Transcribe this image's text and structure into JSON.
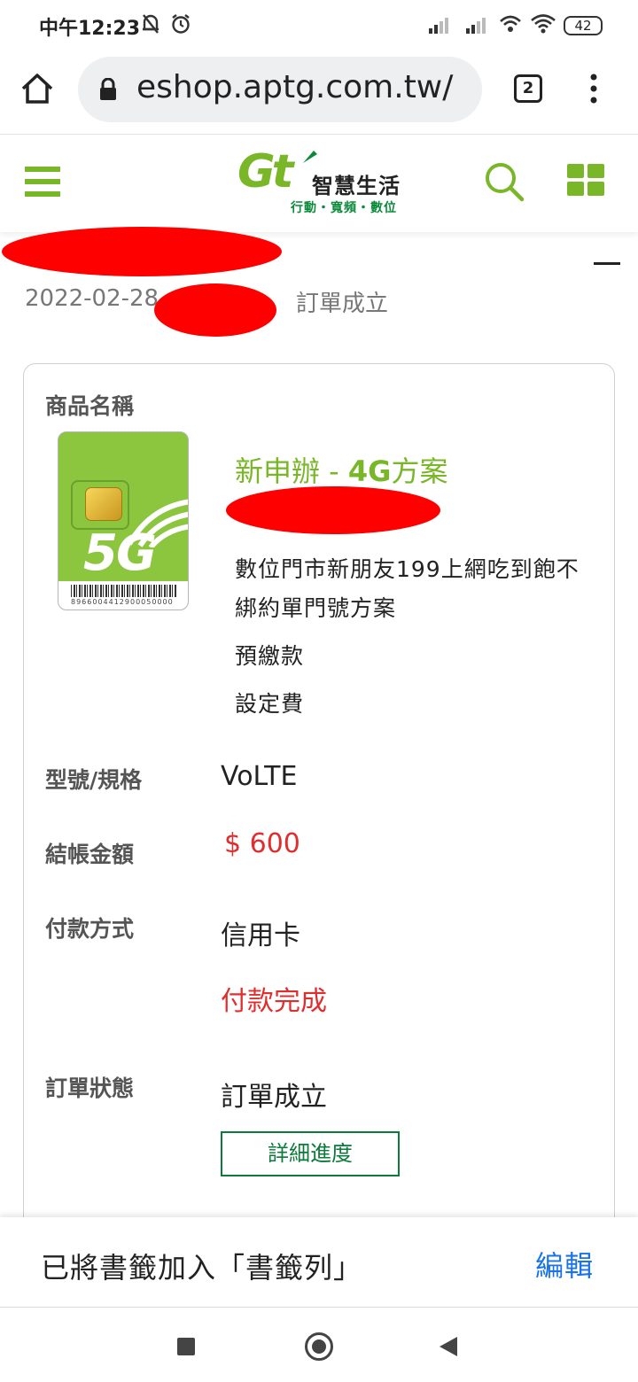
{
  "status_bar": {
    "time": "中午12:23",
    "battery": "42"
  },
  "browser": {
    "url": "eshop.aptg.com.tw/",
    "tab_count": "2"
  },
  "site": {
    "logo_mark": "Gt",
    "logo_name": "智慧生活",
    "logo_tagline": "行動・寬頻・數位",
    "brand_color": "#79b729"
  },
  "order": {
    "date": "2022-02-28",
    "status": "訂單成立"
  },
  "product": {
    "section_label": "商品名稱",
    "title_prefix": "新申辦 - ",
    "title_bold": "4G",
    "title_suffix": "方案",
    "description": "數位門市新朋友199上網吃到飽不綁約單門號方案",
    "item_prepaid": "預繳款",
    "item_setup": "設定費",
    "sim_number": "8966004412900050000",
    "sim_badge": "5G"
  },
  "details": {
    "spec_label": "型號/規格",
    "spec_value": "VoLTE",
    "amount_label": "結帳金額",
    "amount_value": "$ 600",
    "payment_label": "付款方式",
    "payment_method": "信用卡",
    "payment_status": "付款完成",
    "order_status_label": "訂單狀態",
    "order_status_value": "訂單成立",
    "detail_button": "詳細進度"
  },
  "toast": {
    "message": "已將書籤加入「書籤列」",
    "edit_label": "編輯"
  }
}
